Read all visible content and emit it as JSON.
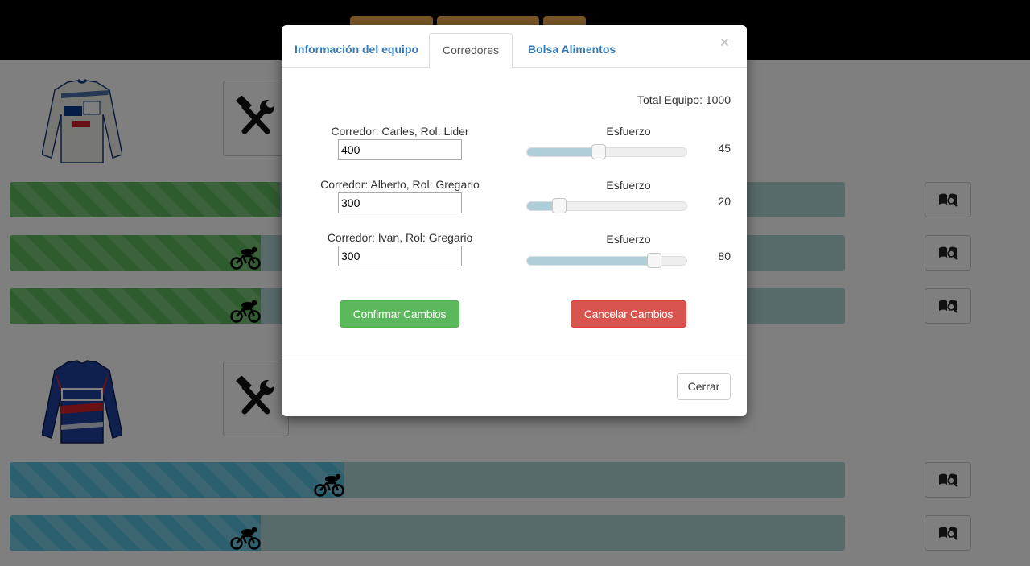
{
  "modal": {
    "tabs": [
      {
        "label": "Información del equipo"
      },
      {
        "label": "Corredores"
      },
      {
        "label": "Bolsa Alimentos"
      }
    ],
    "close_symbol": "×",
    "total": "Total Equipo: 1000",
    "riders": [
      {
        "label": "Corredor: Carles, Rol: Lider",
        "value": "400",
        "effort_label": "Esfuerzo",
        "effort": 45
      },
      {
        "label": "Corredor: Alberto, Rol: Gregario",
        "value": "300",
        "effort_label": "Esfuerzo",
        "effort": 20
      },
      {
        "label": "Corredor: Ivan, Rol: Gregario",
        "value": "300",
        "effort_label": "Esfuerzo",
        "effort": 80
      }
    ],
    "confirm_label": "Confirmar Cambios",
    "cancel_label": "Cancelar Cambios",
    "footer_close_label": "Cerrar"
  },
  "background": {
    "teams": [
      {
        "jersey_text": [
          "FDJ",
          "Bio Mer"
        ],
        "jersey_colors": {
          "body": "#eef0e6",
          "accent": "#0a3a8c"
        }
      },
      {
        "jersey_text": [
          "QUICK STEP"
        ],
        "jersey_colors": {
          "body": "#1f3f9c",
          "accent": "#d5202a"
        }
      }
    ],
    "progress": [
      {
        "color": "green",
        "progress_percent": 33
      },
      {
        "color": "green",
        "progress_percent": 30
      },
      {
        "color": "green",
        "progress_percent": 30
      },
      {
        "color": "blue",
        "progress_percent": 40
      },
      {
        "color": "blue",
        "progress_percent": 30
      }
    ]
  },
  "colors": {
    "primary_link": "#337ab7",
    "success": "#5cb85c",
    "danger": "#d9534f",
    "top_buttons": "#f0ad4e"
  },
  "icons": [
    "tools-icon",
    "bicycle-rider-icon",
    "view-details-icon",
    "close-icon"
  ]
}
